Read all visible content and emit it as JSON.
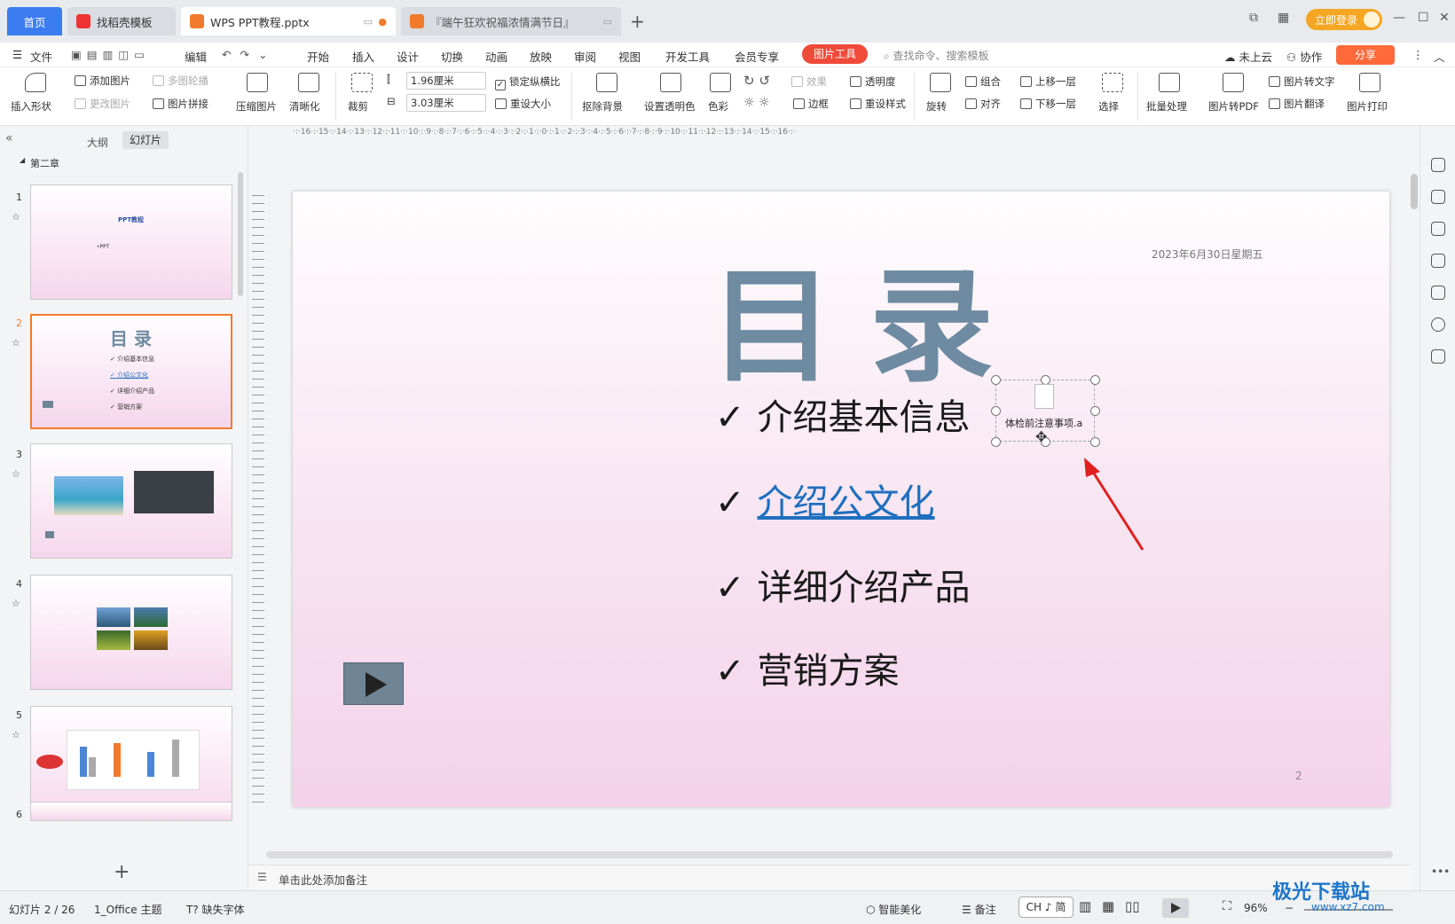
{
  "tabs": {
    "home": "首页",
    "template": "找稻壳模板",
    "wps": "WPS PPT教程.pptx",
    "festival": "『端午狂欢祝福浓情满节日』"
  },
  "topright": {
    "login": "立即登录"
  },
  "menu": {
    "file": "文件",
    "edit": "编辑",
    "items": [
      "开始",
      "插入",
      "设计",
      "切换",
      "动画",
      "放映",
      "审阅",
      "视图",
      "开发工具",
      "会员专享"
    ],
    "pictool": "图片工具",
    "search": "查找命令、搜索模板",
    "cloud": "未上云",
    "collab": "协作",
    "share": "分享"
  },
  "ribbon": {
    "insert_shape": "插入形状",
    "add_picture": "添加图片",
    "change_picture": "更改图片",
    "multi_outline": "多图轮播",
    "picture_collage": "图片拼接",
    "compress": "压缩图片",
    "sharpen": "清晰化",
    "crop": "裁剪",
    "width": "1.96厘米",
    "height": "3.03厘米",
    "lock_ratio": "锁定纵横比",
    "reset_size": "重设大小",
    "remove_bg": "抠除背景",
    "set_transparent": "设置透明色",
    "color": "色彩",
    "effects": "效果",
    "transparency": "透明度",
    "border": "边框",
    "reset_style": "重设样式",
    "rotate": "旋转",
    "group": "组合",
    "align": "对齐",
    "bring_forward": "上移一层",
    "send_backward": "下移一层",
    "select": "选择",
    "batch": "批量处理",
    "to_pdf": "图片转PDF",
    "to_text": "图片转文字",
    "translate": "图片翻译",
    "print": "图片打印"
  },
  "leftpanel": {
    "outline": "大纲",
    "slides": "幻灯片",
    "section": "第二章",
    "thumbs": [
      {
        "num": "1",
        "title": "PPT教程",
        "sub": "•PPT"
      },
      {
        "num": "2",
        "title": "目 录",
        "items": [
          "✓ 介绍基本信息",
          "✓ 介绍公文化",
          "✓ 详细介绍产品",
          "✓ 营销方案"
        ]
      },
      {
        "num": "3"
      },
      {
        "num": "4"
      },
      {
        "num": "5"
      },
      {
        "num": "6"
      }
    ]
  },
  "slide": {
    "title": "目录",
    "date": "2023年6月30日星期五",
    "bullets": [
      "介绍基本信息",
      "介绍公文化",
      "详细介绍产品",
      "营销方案"
    ],
    "check": "✓",
    "object_label": "体检前注意事项.a",
    "page_number": "2"
  },
  "notes": "单击此处添加备注",
  "status": {
    "slide_pos": "幻灯片 2 / 26",
    "theme": "1_Office 主题",
    "missing_font": "缺失字体",
    "beautify": "智能美化",
    "notes_btn": "备注",
    "ime": "CH ♪ 简",
    "zoom": "96%"
  },
  "watermark": {
    "main": "极光下载站",
    "sub": "www.xz7.com"
  }
}
